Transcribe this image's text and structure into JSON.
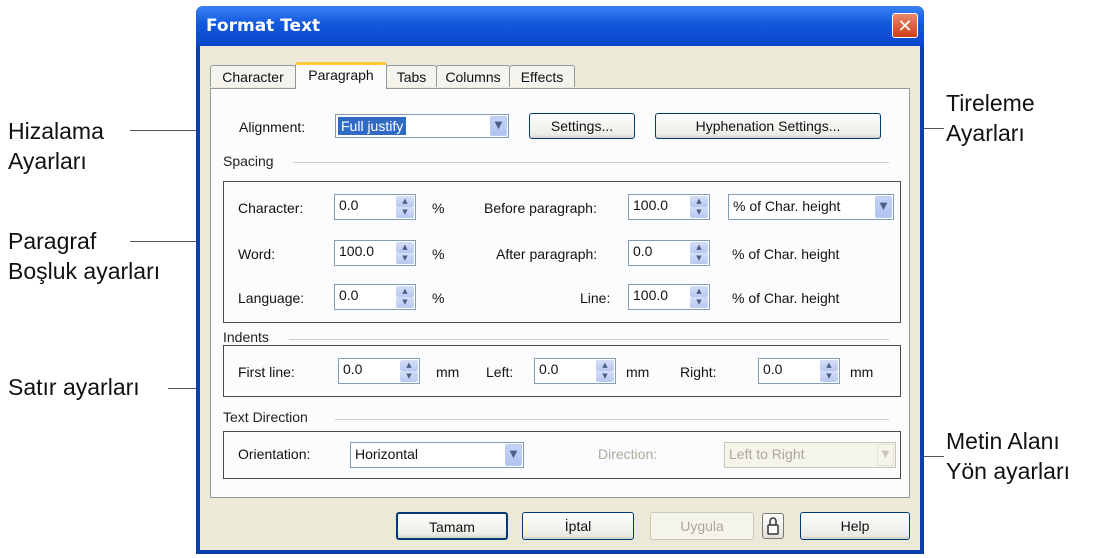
{
  "annotations": {
    "alignment": [
      "Hizalama",
      "Ayarları"
    ],
    "paragraph_spacing": [
      "Paragraf",
      "Boşluk ayarları"
    ],
    "line": [
      "Satır ayarları"
    ],
    "hyphenation": [
      "Tireleme",
      "Ayarları"
    ],
    "text_direction": [
      "Metin Alanı",
      "Yön ayarları"
    ]
  },
  "dialog": {
    "title": "Format Text",
    "close_glyph": "✕",
    "tabs": [
      "Character",
      "Paragraph",
      "Tabs",
      "Columns",
      "Effects"
    ],
    "active_tab": "Paragraph"
  },
  "alignment": {
    "label": "Alignment:",
    "value": "Full justify",
    "settings_button": "Settings...",
    "hyphenation_button": "Hyphenation Settings..."
  },
  "spacing": {
    "section": "Spacing",
    "character": {
      "label": "Character:",
      "value": "0.0",
      "unit": "%"
    },
    "word": {
      "label": "Word:",
      "value": "100.0",
      "unit": "%"
    },
    "language": {
      "label": "Language:",
      "value": "0.0",
      "unit": "%"
    },
    "before": {
      "label": "Before paragraph:",
      "value": "100.0",
      "unit_select": "% of Char. height"
    },
    "after": {
      "label": "After paragraph:",
      "value": "0.0",
      "unit": "% of Char. height"
    },
    "line": {
      "label": "Line:",
      "value": "100.0",
      "unit": "% of Char. height"
    }
  },
  "indents": {
    "section": "Indents",
    "first": {
      "label": "First line:",
      "value": "0.0",
      "unit": "mm"
    },
    "left": {
      "label": "Left:",
      "value": "0.0",
      "unit": "mm"
    },
    "right": {
      "label": "Right:",
      "value": "0.0",
      "unit": "mm"
    }
  },
  "text_direction": {
    "section": "Text Direction",
    "orientation_label": "Orientation:",
    "orientation_value": "Horizontal",
    "direction_label": "Direction:",
    "direction_value": "Left to Right"
  },
  "footer": {
    "ok": "Tamam",
    "cancel": "İptal",
    "apply": "Uygula",
    "help": "Help"
  },
  "icons": {
    "spin_up": "▲",
    "spin_down": "▼",
    "dropdown": "▼"
  }
}
